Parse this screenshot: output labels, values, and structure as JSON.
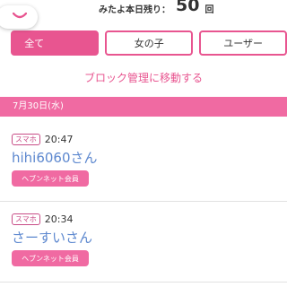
{
  "header": {
    "remaining_label": "みたよ本日残り：",
    "remaining_count": "50",
    "remaining_unit": "回"
  },
  "tabs": [
    {
      "label": "全て",
      "active": true
    },
    {
      "label": "女の子",
      "active": false
    },
    {
      "label": "ユーザー",
      "active": false
    }
  ],
  "block_link": "ブロック管理に移動する",
  "date": "7月30日(水)",
  "entries": [
    {
      "badge": "スマホ",
      "time": "20:47",
      "name": "hihi6060さん",
      "member_label": "ヘブンネット会員"
    },
    {
      "badge": "スマホ",
      "time": "20:34",
      "name": "さーすいさん",
      "member_label": "ヘブンネット会員"
    }
  ],
  "colors": {
    "accent": "#e85590",
    "date_bar": "#f06aa2",
    "username": "#5d88cf"
  }
}
